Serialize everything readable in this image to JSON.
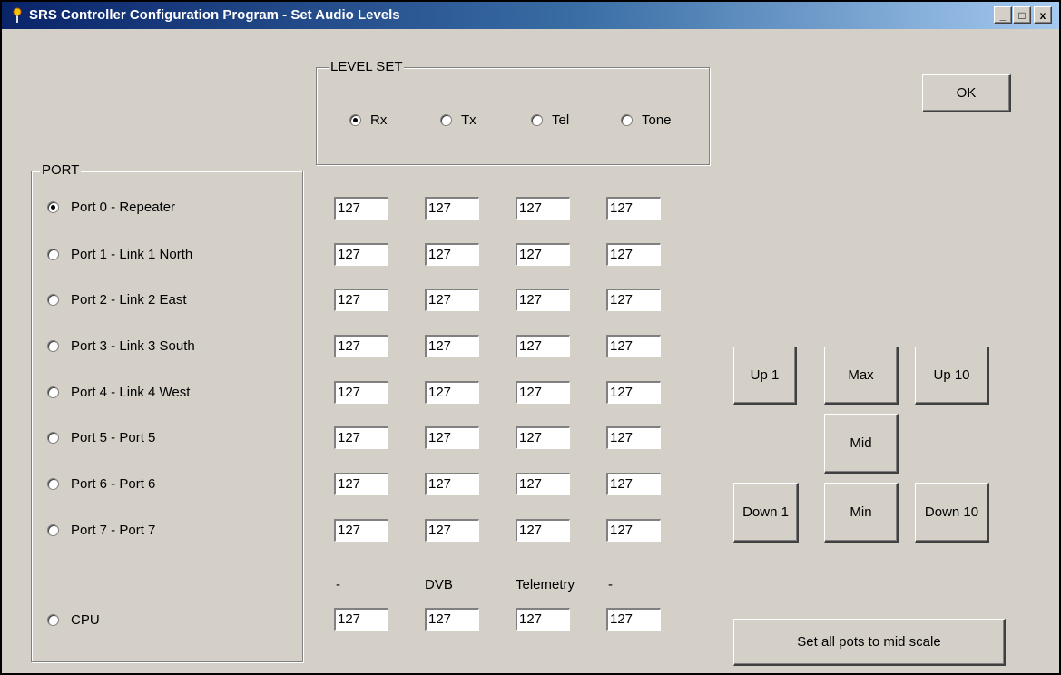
{
  "window": {
    "title": "SRS Controller Configuration Program - Set Audio Levels",
    "minimize_glyph": "_",
    "maximize_glyph": "□",
    "close_glyph": "x"
  },
  "level_set": {
    "label": "LEVEL SET",
    "options": [
      "Rx",
      "Tx",
      "Tel",
      "Tone"
    ],
    "selected": "Rx"
  },
  "port": {
    "label": "PORT",
    "items": [
      "Port 0 - Repeater",
      "Port 1 - Link 1 North",
      "Port 2 - Link 2 East",
      "Port 3 - Link 3 South",
      "Port 4 - Link 4 West",
      "Port 5 - Port 5",
      "Port 6 - Port 6",
      "Port 7 - Port 7",
      "CPU"
    ],
    "selected": "Port 0 - Repeater"
  },
  "levels": {
    "rows": [
      [
        "127",
        "127",
        "127",
        "127"
      ],
      [
        "127",
        "127",
        "127",
        "127"
      ],
      [
        "127",
        "127",
        "127",
        "127"
      ],
      [
        "127",
        "127",
        "127",
        "127"
      ],
      [
        "127",
        "127",
        "127",
        "127"
      ],
      [
        "127",
        "127",
        "127",
        "127"
      ],
      [
        "127",
        "127",
        "127",
        "127"
      ],
      [
        "127",
        "127",
        "127",
        "127"
      ],
      [
        "127",
        "127",
        "127",
        "127"
      ]
    ],
    "cpu_headers": [
      "-",
      "DVB",
      "Telemetry",
      "-"
    ]
  },
  "buttons": {
    "ok": "OK",
    "up1": "Up 1",
    "max": "Max",
    "up10": "Up 10",
    "mid": "Mid",
    "down1": "Down 1",
    "min": "Min",
    "down10": "Down 10",
    "set_all_mid": "Set all pots to mid scale"
  },
  "colors": {
    "titlebar_start": "#0a246a",
    "titlebar_end": "#a6caf0",
    "face": "#d4d0c8"
  }
}
